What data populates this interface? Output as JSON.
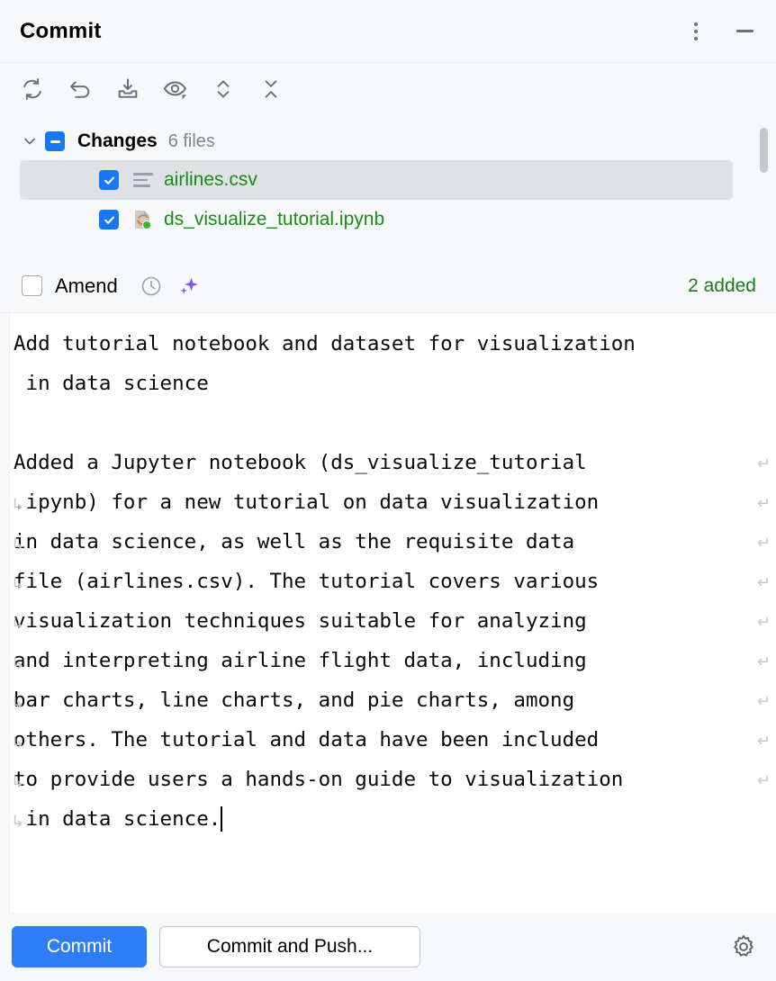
{
  "window": {
    "title": "Commit",
    "menu_icon": "more-vertical-icon",
    "minimize_icon": "minimize-icon"
  },
  "toolbar": {
    "items": [
      {
        "icon": "refresh-icon",
        "label": "Refresh Changes"
      },
      {
        "icon": "rollback-icon",
        "label": "Rollback"
      },
      {
        "icon": "shelve-icon",
        "label": "Shelve Silently"
      },
      {
        "icon": "eye-icon",
        "label": "Show Diff Preview"
      },
      {
        "icon": "expand-collapse-icon",
        "label": "Expand or Collapse"
      },
      {
        "icon": "collapse-all-icon",
        "label": "Collapse All"
      }
    ]
  },
  "changes": {
    "expand_icon": "chevron-down-icon",
    "group_checkbox_state": "indeterminate",
    "group_label": "Changes",
    "group_count": "6 files",
    "files": [
      {
        "name": "airlines.csv",
        "checked": true,
        "icon": "csv-file-icon",
        "selected": true,
        "color": "#178c18"
      },
      {
        "name": "ds_visualize_tutorial.ipynb",
        "checked": false,
        "icon": "jupyter-notebook-icon",
        "selected": false,
        "color": "#178c18"
      }
    ]
  },
  "amend": {
    "checked": false,
    "label": "Amend",
    "history_icon": "clock-icon",
    "ai_icon": "sparkle-icon",
    "status": "2 added",
    "status_color": "#1a7f1a"
  },
  "commit_message": {
    "lines": [
      {
        "text": "Add tutorial notebook and dataset for visualization",
        "wrap_left": false,
        "wrap_right": false
      },
      {
        "text": " in data science",
        "wrap_left": false,
        "wrap_right": false
      },
      {
        "text": "",
        "wrap_left": false,
        "wrap_right": false
      },
      {
        "text": "Added a Jupyter notebook (ds_visualize_tutorial",
        "wrap_left": false,
        "wrap_right": true
      },
      {
        "text": ".ipynb) for a new tutorial on data visualization",
        "wrap_left": true,
        "wrap_right": true
      },
      {
        "text": "in data science, as well as the requisite data",
        "wrap_left": true,
        "wrap_right": true
      },
      {
        "text": "file (airlines.csv). The tutorial covers various",
        "wrap_left": true,
        "wrap_right": true
      },
      {
        "text": "visualization techniques suitable for analyzing",
        "wrap_left": true,
        "wrap_right": true
      },
      {
        "text": "and interpreting airline flight data, including",
        "wrap_left": true,
        "wrap_right": true
      },
      {
        "text": "bar charts, line charts, and pie charts, among",
        "wrap_left": true,
        "wrap_right": true
      },
      {
        "text": "others. The tutorial and data have been included",
        "wrap_left": true,
        "wrap_right": true
      },
      {
        "text": "to provide users a hands-on guide to visualization",
        "wrap_left": true,
        "wrap_right": true
      },
      {
        "text": " in data science.",
        "wrap_left": true,
        "wrap_right": false,
        "caret": true
      }
    ]
  },
  "footer": {
    "commit_label": "Commit",
    "commit_push_label": "Commit and Push...",
    "settings_icon": "gear-icon"
  },
  "colors": {
    "accent_blue": "#2f7df4",
    "checkbox_blue": "#1877f2",
    "added_green": "#1a7f1a",
    "file_green": "#178c18",
    "panel_bg": "#f7f8fa",
    "editor_bg": "#ffffff",
    "selection_bg": "#dfe1e5",
    "purple_sparkle": "#7f52ff"
  }
}
